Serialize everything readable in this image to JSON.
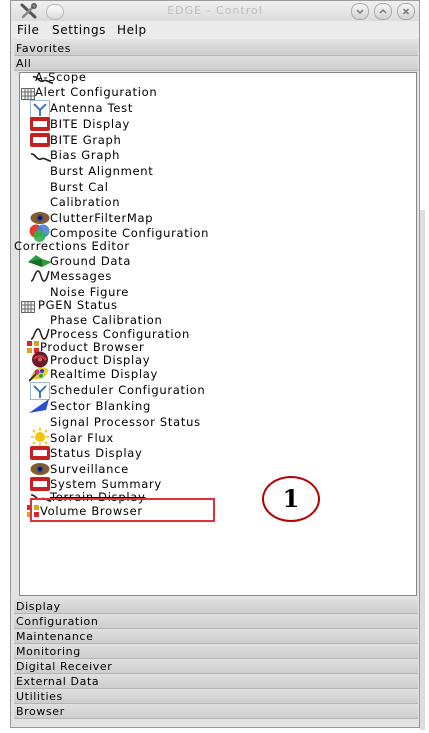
{
  "window": {
    "title": "EDGE - Control",
    "accent_color": "#e0303a"
  },
  "menubar": {
    "items": [
      "File",
      "Settings",
      "Help"
    ]
  },
  "sections": {
    "favorites": "Favorites",
    "all": "All"
  },
  "list_items": [
    {
      "label": "A-Scope",
      "icon": "wave-graph-icon"
    },
    {
      "label": "Alert Configuration",
      "icon": "grid-table-icon"
    },
    {
      "label": "Antenna Test",
      "icon": "antenna-icon"
    },
    {
      "label": "BITE Display",
      "icon": "bite-chip-icon"
    },
    {
      "label": "BITE Graph",
      "icon": "bite-chip-icon"
    },
    {
      "label": "Bias Graph",
      "icon": "wave-graph-icon"
    },
    {
      "label": "Burst Alignment",
      "icon": ""
    },
    {
      "label": "Burst Cal",
      "icon": ""
    },
    {
      "label": "Calibration",
      "icon": ""
    },
    {
      "label": "ClutterFilterMap",
      "icon": "eye-icon"
    },
    {
      "label": "Composite Configuration",
      "icon": "color-circles-icon"
    },
    {
      "label": "Corrections Editor",
      "icon": ""
    },
    {
      "label": "Ground Data",
      "icon": "terrain-icon"
    },
    {
      "label": "Messages",
      "icon": "signal-wave-icon"
    },
    {
      "label": "Noise Figure",
      "icon": ""
    },
    {
      "label": "PGEN Status",
      "icon": "grid-table-icon"
    },
    {
      "label": "Phase Calibration",
      "icon": ""
    },
    {
      "label": "Process Configuration",
      "icon": "signal-wave-icon"
    },
    {
      "label": "Product Browser",
      "icon": "grid-dots-icon"
    },
    {
      "label": "Product Display",
      "icon": "radar-globe-icon"
    },
    {
      "label": "Realtime Display",
      "icon": "palette-icon"
    },
    {
      "label": "Scheduler Configuration",
      "icon": "antenna-icon"
    },
    {
      "label": "Sector Blanking",
      "icon": "blue-wedge-icon"
    },
    {
      "label": "Signal Processor Status",
      "icon": ""
    },
    {
      "label": "Solar Flux",
      "icon": "sun-icon"
    },
    {
      "label": "Status Display",
      "icon": "bite-chip-icon"
    },
    {
      "label": "Surveillance",
      "icon": "eye-icon"
    },
    {
      "label": "System Summary",
      "icon": "bite-chip-icon"
    },
    {
      "label": "Terrain Display",
      "icon": "wave-graph-icon"
    },
    {
      "label": "Volume Browser",
      "icon": "grid-dots-icon"
    }
  ],
  "bottom_sections": [
    "Display",
    "Configuration",
    "Maintenance",
    "Monitoring",
    "Digital Receiver",
    "External Data",
    "Utilities",
    "Browser"
  ],
  "callout": {
    "number": "1"
  }
}
